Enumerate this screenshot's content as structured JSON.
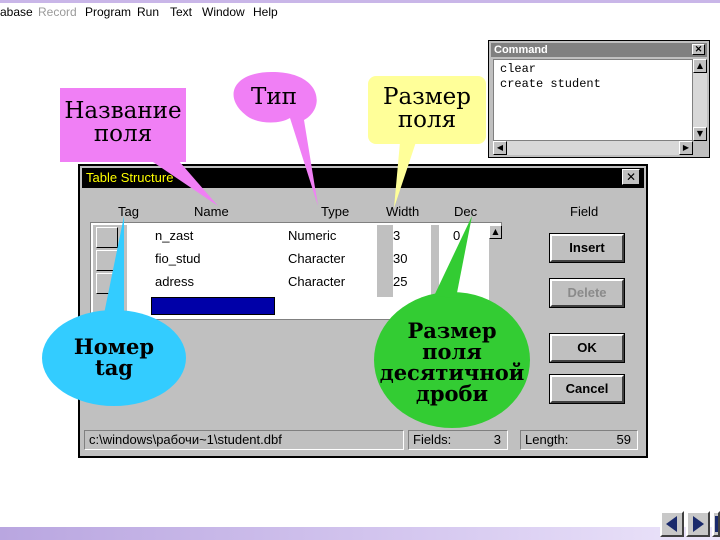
{
  "menu": {
    "items": [
      {
        "label": "abase",
        "disabled": false
      },
      {
        "label": "Record",
        "disabled": true
      },
      {
        "label": "Program",
        "disabled": false
      },
      {
        "label": "Run",
        "disabled": false
      },
      {
        "label": "Text",
        "disabled": false
      },
      {
        "label": "Window",
        "disabled": false
      },
      {
        "label": "Help",
        "disabled": false
      }
    ]
  },
  "command_window": {
    "title": "Command",
    "lines": [
      "clear",
      "create student"
    ]
  },
  "dialog": {
    "title": "Table Structure",
    "headers": {
      "tag": "Tag",
      "name": "Name",
      "type": "Type",
      "width": "Width",
      "dec": "Dec",
      "field": "Field"
    },
    "rows": [
      {
        "name": "n_zast",
        "type": "Numeric",
        "width": "3",
        "dec": "0"
      },
      {
        "name": "fio_stud",
        "type": "Character",
        "width": "30",
        "dec": ""
      },
      {
        "name": "adress",
        "type": "Character",
        "width": "25",
        "dec": ""
      }
    ],
    "buttons": {
      "insert": "Insert",
      "delete": "Delete",
      "ok": "OK",
      "cancel": "Cancel"
    },
    "status": {
      "path": "c:\\windows\\рабочи~1\\student.dbf",
      "fields_label": "Fields:",
      "fields_value": "3",
      "length_label": "Length:",
      "length_value": "59"
    }
  },
  "callouts": {
    "name": [
      "Название",
      "поля"
    ],
    "type": [
      "Тип"
    ],
    "width": [
      "Размер",
      "поля"
    ],
    "tag": [
      "Номер",
      "tag"
    ],
    "dec": [
      "Размер",
      "поля",
      "десятичной",
      "дроби"
    ]
  },
  "colors": {
    "callout_pink": "#f07ff5",
    "callout_yellow": "#ffff99",
    "callout_cyan": "#33ccff",
    "callout_green": "#33cc33",
    "title_bar": "#000000",
    "title_text": "#ffff00",
    "new_field": "#0000a8"
  },
  "icons": {
    "close": "close-icon",
    "scroll_up": "arrow-up-icon",
    "nav_first": "nav-first-icon",
    "nav_next": "nav-next-icon",
    "nav_last": "nav-last-icon"
  }
}
